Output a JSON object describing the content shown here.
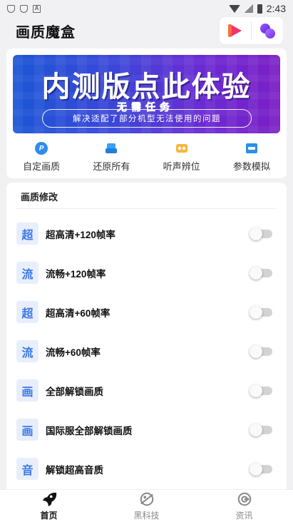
{
  "status_bar": {
    "time": "2:43",
    "notification_a": "A"
  },
  "header": {
    "title": "画质魔盒"
  },
  "banner": {
    "title": "内测版点此体验",
    "stamp": "无需任务",
    "subtitle": "解决适配了部分机型无法使用的问题"
  },
  "shortcuts": [
    {
      "label": "自定画质",
      "icon": "p-icon",
      "glyph": "P",
      "color": "#2e8cf0"
    },
    {
      "label": "还原所有",
      "icon": "restore-icon",
      "glyph": "",
      "color": "#3aa0f0"
    },
    {
      "label": "听声辨位",
      "icon": "sound-locate-icon",
      "glyph": "",
      "color": "#f5b73b"
    },
    {
      "label": "参数模拟",
      "icon": "simulate-icon",
      "glyph": "",
      "color": "#2a8fe8"
    }
  ],
  "section": {
    "title": "画质修改"
  },
  "settings": [
    {
      "badge": "超",
      "label": "超高清+120帧率",
      "enabled": false
    },
    {
      "badge": "流",
      "label": "流畅+120帧率",
      "enabled": false
    },
    {
      "badge": "超",
      "label": "超高清+60帧率",
      "enabled": false
    },
    {
      "badge": "流",
      "label": "流畅+60帧率",
      "enabled": false
    },
    {
      "badge": "画",
      "label": "全部解锁画质",
      "enabled": false
    },
    {
      "badge": "画",
      "label": "国际服全部解锁画质",
      "enabled": false
    },
    {
      "badge": "音",
      "label": "解锁超高音质",
      "enabled": false
    }
  ],
  "nav": {
    "items": [
      {
        "label": "首页",
        "icon": "rocket-icon",
        "active": true
      },
      {
        "label": "黑科技",
        "icon": "planet-icon",
        "active": false
      },
      {
        "label": "资讯",
        "icon": "news-icon",
        "active": false
      }
    ]
  },
  "colors": {
    "accent": "#3a78e8",
    "background": "#f1f1f4",
    "banner_start": "#1b56d6",
    "banner_end": "#7b1fc5"
  }
}
